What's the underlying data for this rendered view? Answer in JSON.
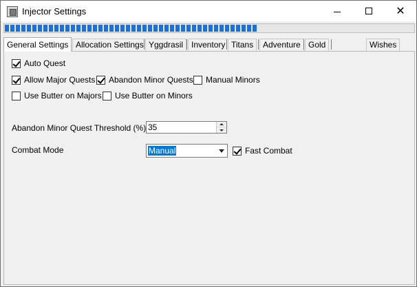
{
  "window": {
    "title": "Injector Settings"
  },
  "progress": {
    "value_fraction": 0.62,
    "color": "#1c6fd4"
  },
  "tabs": [
    {
      "label": "General Settings",
      "active": true
    },
    {
      "label": "Allocation Settings",
      "active": false
    },
    {
      "label": "Yggdrasil",
      "active": false
    },
    {
      "label": "Inventory",
      "active": false
    },
    {
      "label": "Titans",
      "active": false
    },
    {
      "label": "Adventure",
      "active": false
    },
    {
      "label": "Gold",
      "active": false
    },
    {
      "label": "Wishes",
      "active": false
    }
  ],
  "general": {
    "auto_quest": {
      "label": "Auto Quest",
      "checked": true
    },
    "allow_major_quests": {
      "label": "Allow Major Quests",
      "checked": true
    },
    "abandon_minor_quests": {
      "label": "Abandon Minor Quests",
      "checked": true
    },
    "manual_minors": {
      "label": "Manual Minors",
      "checked": false
    },
    "use_butter_majors": {
      "label": "Use Butter on Majors",
      "checked": false
    },
    "use_butter_minors": {
      "label": "Use Butter on Minors",
      "checked": false
    },
    "threshold_label": "Abandon Minor Quest Threshold (%)",
    "threshold_value": "35",
    "combat_mode_label": "Combat Mode",
    "combat_mode_value": "Manual",
    "fast_combat": {
      "label": "Fast Combat",
      "checked": true
    }
  },
  "icons": {
    "app": "app-window-icon",
    "minimize": "minimize-icon",
    "maximize": "maximize-icon",
    "close": "close-icon"
  }
}
